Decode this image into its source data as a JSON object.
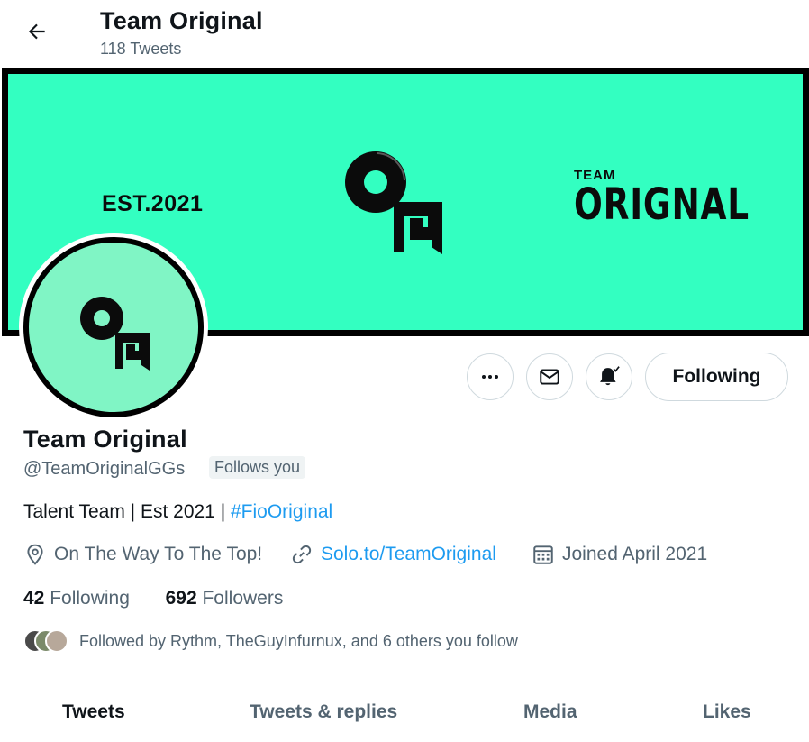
{
  "header": {
    "back_icon": "arrow-left-icon",
    "title": "Team Original",
    "tweet_count": "118 Tweets"
  },
  "banner": {
    "est_text": "EST.2021",
    "brand_small": "TEAM",
    "brand_big": "ORIGNAL",
    "background_color": "#33ffc1"
  },
  "actions": {
    "more_icon": "more-horizontal-icon",
    "message_icon": "mail-icon",
    "notify_icon": "bell-check-icon",
    "following_label": "Following"
  },
  "profile": {
    "name": "Team Original",
    "handle": "@TeamOriginalGGs",
    "follows_you": "Follows you",
    "bio_text": "Talent Team | Est 2021 | ",
    "bio_hashtag": "#FioOriginal",
    "location": "On The Way To The Top!",
    "website": "Solo.to/TeamOriginal",
    "joined": "Joined April 2021",
    "following_count": "42",
    "following_label": " Following",
    "followers_count": "692",
    "followers_label": " Followers",
    "followed_by": "Followed by Rythm, TheGuyInfurnux, and 6 others you follow"
  },
  "tabs": [
    {
      "label": "Tweets",
      "active": true
    },
    {
      "label": "Tweets & replies",
      "active": false
    },
    {
      "label": "Media",
      "active": false
    },
    {
      "label": "Likes",
      "active": false
    }
  ],
  "colors": {
    "accent": "#1d9bf0",
    "text_primary": "#0f1419",
    "text_secondary": "#536471",
    "avatar_bg": "#80f5c5"
  }
}
